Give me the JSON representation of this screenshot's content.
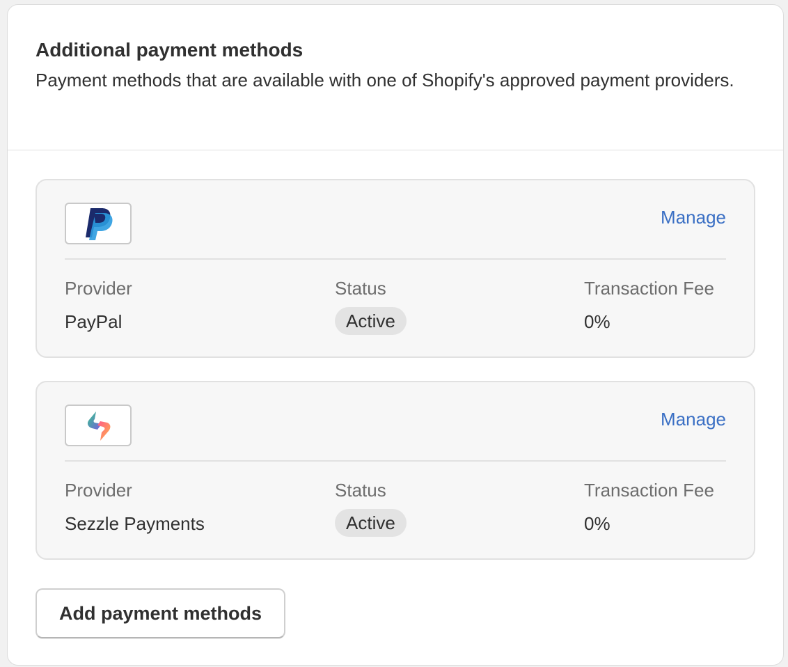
{
  "section": {
    "title": "Additional payment methods",
    "description": "Payment methods that are available with one of Shopify's approved payment providers."
  },
  "methods": [
    {
      "logo_icon": "paypal-logo-icon",
      "manage_label": "Manage",
      "provider_label": "Provider",
      "provider": "PayPal",
      "status_label": "Status",
      "status": "Active",
      "fee_label": "Transaction Fee",
      "fee": "0%"
    },
    {
      "logo_icon": "sezzle-logo-icon",
      "manage_label": "Manage",
      "provider_label": "Provider",
      "provider": "Sezzle Payments",
      "status_label": "Status",
      "status": "Active",
      "fee_label": "Transaction Fee",
      "fee": "0%"
    }
  ],
  "add_button_label": "Add payment methods",
  "colors": {
    "link": "#3a6fc4",
    "badge_bg": "#e3e3e3",
    "card_bg": "#f7f7f7"
  }
}
